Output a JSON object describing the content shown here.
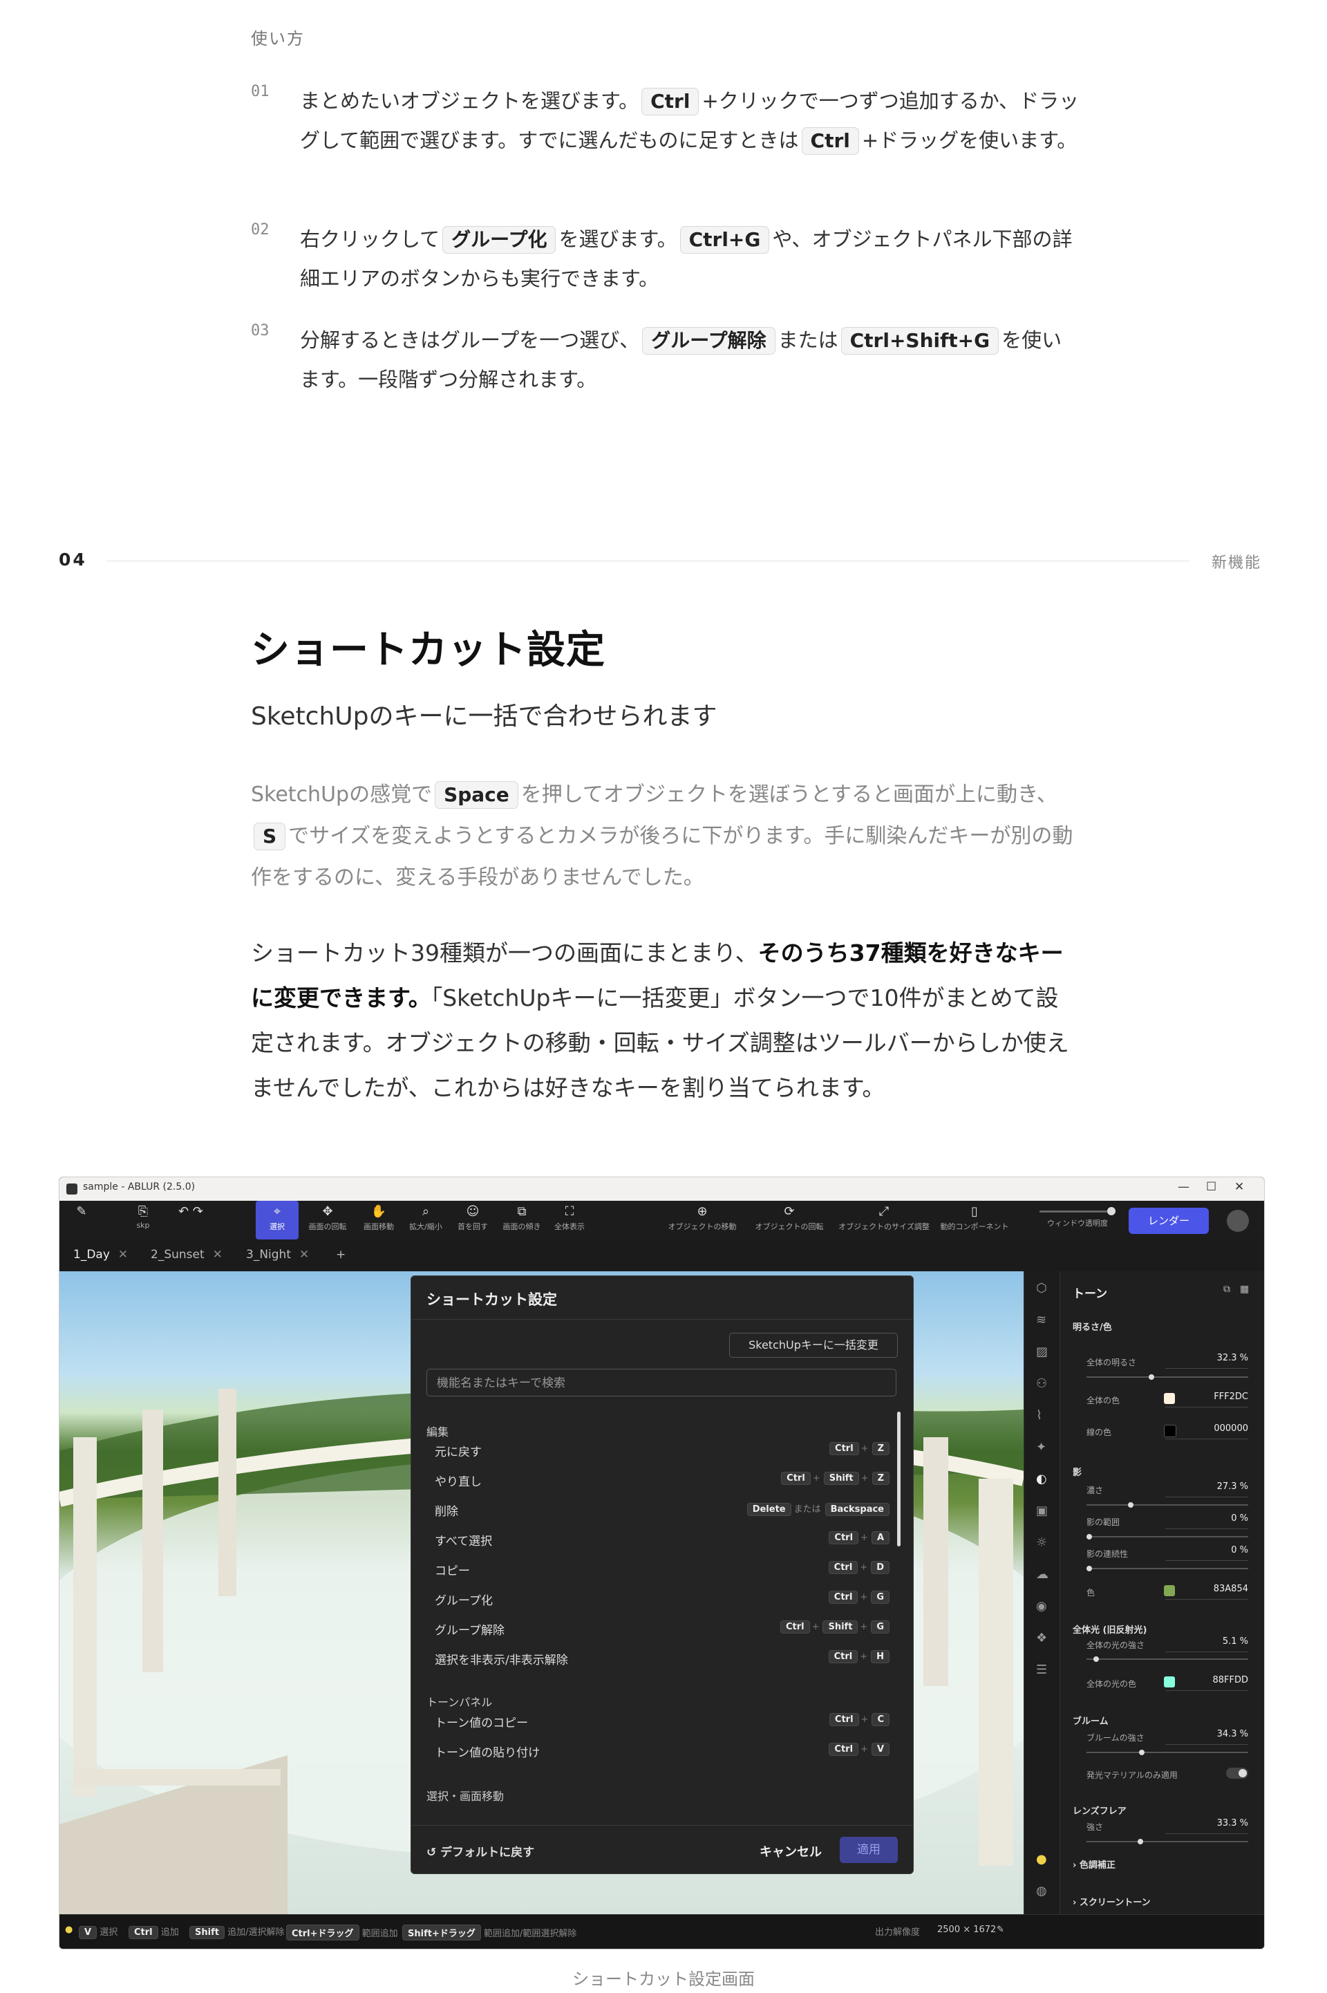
{
  "usage": {
    "title": "使い方",
    "steps": [
      {
        "num": "01",
        "parts": [
          "まとめたいオブジェクトを選びます。",
          "Ctrl",
          "+クリックで一つずつ追加するか、ドラッグして範囲で選びます。すでに選んだものに足すときは",
          "Ctrl",
          "+ドラッグを使います。"
        ]
      },
      {
        "num": "02",
        "parts": [
          "右クリックして",
          "グループ化",
          "を選びます。",
          "Ctrl+G",
          "や、オブジェクトパネル下部の詳細エリアのボタンからも実行できます。"
        ]
      },
      {
        "num": "03",
        "parts": [
          "分解するときはグループを一つ選び、",
          "グループ解除",
          "または",
          "Ctrl+Shift+G",
          "を使います。一段階ずつ分解されます。"
        ]
      }
    ]
  },
  "section": {
    "number": "04",
    "tag": "新機能",
    "heading": "ショートカット設定",
    "subheading": "SketchUpのキーに一括で合わせられます",
    "intro": [
      "SketchUpの感覚で",
      "Space",
      "を押してオブジェクトを選ぼうとすると画面が上に動き、",
      "S",
      "でサイズを変えようとするとカメラが後ろに下がります。手に馴染んだキーが別の動作をするのに、変える手段がありませんでした。"
    ],
    "body_pre": "ショートカット39種類が一つの画面にまとまり、",
    "body_bold": "そのうち37種類を好きなキーに変更できます。",
    "body_post": "「SketchUpキーに一括変更」ボタン一つで10件がまとめて設定されます。オブジェクトの移動・回転・サイズ調整はツールバーからしか使えませんでしたが、これからは好きなキーを割り当てられます。"
  },
  "app": {
    "window_title": "sample - ABLUR (2.5.0)",
    "toolbar": [
      {
        "label": "skp",
        "icon": "⎘"
      },
      {
        "label": "",
        "icon": "↶ ↷"
      },
      {
        "label": "選択",
        "icon": "⌖",
        "active": true
      },
      {
        "label": "画面の回転",
        "icon": "✥"
      },
      {
        "label": "画面移動",
        "icon": "✋"
      },
      {
        "label": "拡大/縮小",
        "icon": "⌕"
      },
      {
        "label": "首を回す",
        "icon": "☺"
      },
      {
        "label": "画面の傾き",
        "icon": "⧉"
      },
      {
        "label": "全体表示",
        "icon": "⛶"
      },
      {
        "label": "オブジェクトの移動",
        "icon": "⊕"
      },
      {
        "label": "オブジェクトの回転",
        "icon": "⟳"
      },
      {
        "label": "オブジェクトのサイズ調整",
        "icon": "⤢"
      },
      {
        "label": "動的コンポーネント",
        "icon": "▯"
      }
    ],
    "opacity_label": "ウィンドウ透明度",
    "render_label": "レンダー",
    "tabs": [
      "1_Day",
      "2_Sunset",
      "3_Night"
    ],
    "add_tab": "+",
    "dialog": {
      "title": "ショートカット設定",
      "sketchup_button": "SketchUpキーに一括変更",
      "search_placeholder": "機能名またはキーで検索",
      "groups": [
        {
          "name": "編集",
          "rows": [
            {
              "label": "元に戻す",
              "keys": [
                "Ctrl",
                "Z"
              ]
            },
            {
              "label": "やり直し",
              "keys": [
                "Ctrl",
                "Shift",
                "Z"
              ]
            },
            {
              "label": "削除",
              "keys": [
                "Delete"
              ],
              "alt": "Backspace",
              "or": "または"
            },
            {
              "label": "すべて選択",
              "keys": [
                "Ctrl",
                "A"
              ]
            },
            {
              "label": "コピー",
              "keys": [
                "Ctrl",
                "D"
              ]
            },
            {
              "label": "グループ化",
              "keys": [
                "Ctrl",
                "G"
              ]
            },
            {
              "label": "グループ解除",
              "keys": [
                "Ctrl",
                "Shift",
                "G"
              ]
            },
            {
              "label": "選択を非表示/非表示解除",
              "keys": [
                "Ctrl",
                "H"
              ]
            }
          ]
        },
        {
          "name": "トーンパネル",
          "rows": [
            {
              "label": "トーン値のコピー",
              "keys": [
                "Ctrl",
                "C"
              ]
            },
            {
              "label": "トーン値の貼り付け",
              "keys": [
                "Ctrl",
                "V"
              ]
            }
          ]
        },
        {
          "name": "選択・画面移動",
          "rows": []
        }
      ],
      "reset_label": "デフォルトに戻す",
      "cancel_label": "キャンセル",
      "apply_label": "適用"
    },
    "panel": {
      "title": "トーン",
      "sections": {
        "brightness": "明るさ/色",
        "shadow": "影",
        "global_light": "全体光 (旧反射光)",
        "bloom": "ブルーム",
        "lens_flare": "レンズフレア",
        "color_correction": "色調補正",
        "screentone": "スクリーントーン"
      },
      "fields": {
        "overall_brightness": {
          "label": "全体の明るさ",
          "value": "32.3 %"
        },
        "overall_color": {
          "label": "全体の色",
          "value": "FFF2DC",
          "color": "#FFF2DC"
        },
        "line_color": {
          "label": "線の色",
          "value": "000000",
          "color": "#000000"
        },
        "shadow_depth": {
          "label": "濃さ",
          "value": "27.3 %"
        },
        "shadow_range": {
          "label": "影の範囲",
          "value": "0 %"
        },
        "shadow_continuity": {
          "label": "影の連続性",
          "value": "0 %"
        },
        "shadow_color": {
          "label": "色",
          "value": "83A854",
          "color": "#83A854"
        },
        "global_light_strength": {
          "label": "全体の光の強さ",
          "value": "5.1 %"
        },
        "global_light_color": {
          "label": "全体の光の色",
          "value": "88FFDD",
          "color": "#88FFDD"
        },
        "bloom_strength": {
          "label": "ブルームの強さ",
          "value": "34.3 %"
        },
        "emissive_only": {
          "label": "発光マテリアルのみ適用"
        },
        "flare_strength": {
          "label": "強さ",
          "value": "33.3 %"
        }
      }
    },
    "statusbar": {
      "items": [
        {
          "key": "V",
          "desc": "選択"
        },
        {
          "key": "Ctrl",
          "desc": "追加"
        },
        {
          "key": "Shift",
          "desc": "追加/選択解除"
        },
        {
          "key": "Ctrl+ドラッグ",
          "desc": "範囲追加"
        },
        {
          "key": "Shift+ドラッグ",
          "desc": "範囲追加/範囲選択解除"
        }
      ],
      "resolution_label": "出力解像度",
      "resolution": "2500 × 1672"
    }
  },
  "caption": "ショートカット設定画面"
}
